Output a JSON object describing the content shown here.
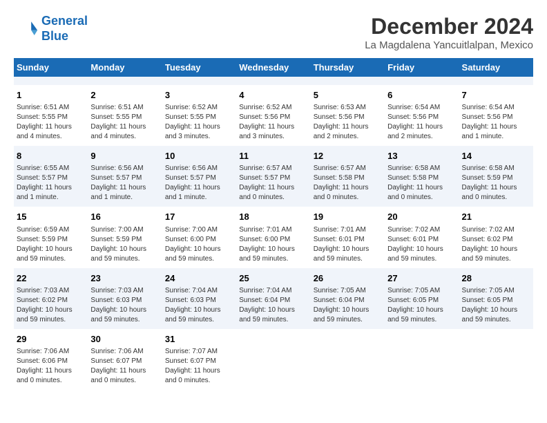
{
  "header": {
    "logo_line1": "General",
    "logo_line2": "Blue",
    "month_title": "December 2024",
    "subtitle": "La Magdalena Yancuitlalpan, Mexico"
  },
  "calendar": {
    "days_of_week": [
      "Sunday",
      "Monday",
      "Tuesday",
      "Wednesday",
      "Thursday",
      "Friday",
      "Saturday"
    ],
    "weeks": [
      [
        {
          "day": "",
          "info": ""
        },
        {
          "day": "",
          "info": ""
        },
        {
          "day": "",
          "info": ""
        },
        {
          "day": "",
          "info": ""
        },
        {
          "day": "",
          "info": ""
        },
        {
          "day": "",
          "info": ""
        },
        {
          "day": "",
          "info": ""
        }
      ],
      [
        {
          "day": "1",
          "info": "Sunrise: 6:51 AM\nSunset: 5:55 PM\nDaylight: 11 hours\nand 4 minutes."
        },
        {
          "day": "2",
          "info": "Sunrise: 6:51 AM\nSunset: 5:55 PM\nDaylight: 11 hours\nand 4 minutes."
        },
        {
          "day": "3",
          "info": "Sunrise: 6:52 AM\nSunset: 5:55 PM\nDaylight: 11 hours\nand 3 minutes."
        },
        {
          "day": "4",
          "info": "Sunrise: 6:52 AM\nSunset: 5:56 PM\nDaylight: 11 hours\nand 3 minutes."
        },
        {
          "day": "5",
          "info": "Sunrise: 6:53 AM\nSunset: 5:56 PM\nDaylight: 11 hours\nand 2 minutes."
        },
        {
          "day": "6",
          "info": "Sunrise: 6:54 AM\nSunset: 5:56 PM\nDaylight: 11 hours\nand 2 minutes."
        },
        {
          "day": "7",
          "info": "Sunrise: 6:54 AM\nSunset: 5:56 PM\nDaylight: 11 hours\nand 1 minute."
        }
      ],
      [
        {
          "day": "8",
          "info": "Sunrise: 6:55 AM\nSunset: 5:57 PM\nDaylight: 11 hours\nand 1 minute."
        },
        {
          "day": "9",
          "info": "Sunrise: 6:56 AM\nSunset: 5:57 PM\nDaylight: 11 hours\nand 1 minute."
        },
        {
          "day": "10",
          "info": "Sunrise: 6:56 AM\nSunset: 5:57 PM\nDaylight: 11 hours\nand 1 minute."
        },
        {
          "day": "11",
          "info": "Sunrise: 6:57 AM\nSunset: 5:57 PM\nDaylight: 11 hours\nand 0 minutes."
        },
        {
          "day": "12",
          "info": "Sunrise: 6:57 AM\nSunset: 5:58 PM\nDaylight: 11 hours\nand 0 minutes."
        },
        {
          "day": "13",
          "info": "Sunrise: 6:58 AM\nSunset: 5:58 PM\nDaylight: 11 hours\nand 0 minutes."
        },
        {
          "day": "14",
          "info": "Sunrise: 6:58 AM\nSunset: 5:59 PM\nDaylight: 11 hours\nand 0 minutes."
        }
      ],
      [
        {
          "day": "15",
          "info": "Sunrise: 6:59 AM\nSunset: 5:59 PM\nDaylight: 10 hours\nand 59 minutes."
        },
        {
          "day": "16",
          "info": "Sunrise: 7:00 AM\nSunset: 5:59 PM\nDaylight: 10 hours\nand 59 minutes."
        },
        {
          "day": "17",
          "info": "Sunrise: 7:00 AM\nSunset: 6:00 PM\nDaylight: 10 hours\nand 59 minutes."
        },
        {
          "day": "18",
          "info": "Sunrise: 7:01 AM\nSunset: 6:00 PM\nDaylight: 10 hours\nand 59 minutes."
        },
        {
          "day": "19",
          "info": "Sunrise: 7:01 AM\nSunset: 6:01 PM\nDaylight: 10 hours\nand 59 minutes."
        },
        {
          "day": "20",
          "info": "Sunrise: 7:02 AM\nSunset: 6:01 PM\nDaylight: 10 hours\nand 59 minutes."
        },
        {
          "day": "21",
          "info": "Sunrise: 7:02 AM\nSunset: 6:02 PM\nDaylight: 10 hours\nand 59 minutes."
        }
      ],
      [
        {
          "day": "22",
          "info": "Sunrise: 7:03 AM\nSunset: 6:02 PM\nDaylight: 10 hours\nand 59 minutes."
        },
        {
          "day": "23",
          "info": "Sunrise: 7:03 AM\nSunset: 6:03 PM\nDaylight: 10 hours\nand 59 minutes."
        },
        {
          "day": "24",
          "info": "Sunrise: 7:04 AM\nSunset: 6:03 PM\nDaylight: 10 hours\nand 59 minutes."
        },
        {
          "day": "25",
          "info": "Sunrise: 7:04 AM\nSunset: 6:04 PM\nDaylight: 10 hours\nand 59 minutes."
        },
        {
          "day": "26",
          "info": "Sunrise: 7:05 AM\nSunset: 6:04 PM\nDaylight: 10 hours\nand 59 minutes."
        },
        {
          "day": "27",
          "info": "Sunrise: 7:05 AM\nSunset: 6:05 PM\nDaylight: 10 hours\nand 59 minutes."
        },
        {
          "day": "28",
          "info": "Sunrise: 7:05 AM\nSunset: 6:05 PM\nDaylight: 10 hours\nand 59 minutes."
        }
      ],
      [
        {
          "day": "29",
          "info": "Sunrise: 7:06 AM\nSunset: 6:06 PM\nDaylight: 11 hours\nand 0 minutes."
        },
        {
          "day": "30",
          "info": "Sunrise: 7:06 AM\nSunset: 6:07 PM\nDaylight: 11 hours\nand 0 minutes."
        },
        {
          "day": "31",
          "info": "Sunrise: 7:07 AM\nSunset: 6:07 PM\nDaylight: 11 hours\nand 0 minutes."
        },
        {
          "day": "",
          "info": ""
        },
        {
          "day": "",
          "info": ""
        },
        {
          "day": "",
          "info": ""
        },
        {
          "day": "",
          "info": ""
        }
      ]
    ]
  }
}
